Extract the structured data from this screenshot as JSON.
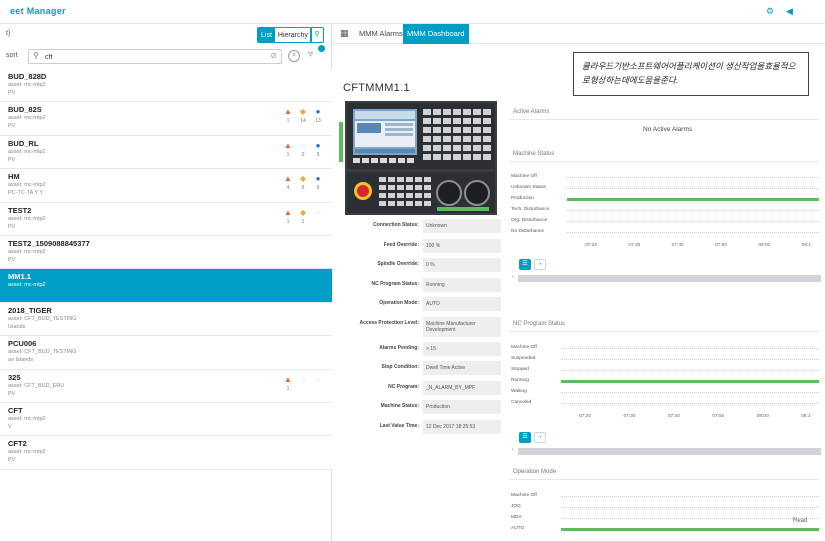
{
  "header": {
    "title": "eet Manager",
    "icons": [
      "settings-icon",
      "collapse-icon"
    ],
    "accent": "#009ec6"
  },
  "left": {
    "top_label": "t)",
    "view_toggle": {
      "list": "List",
      "hierarchy": "Hierarchy"
    },
    "sort_label": "sort",
    "search": {
      "value": "cft",
      "placeholder": ""
    },
    "assets": [
      {
        "name": "BUD_828D",
        "sub": "asset: mc-mtp2",
        "sub2": "PV",
        "icons": []
      },
      {
        "name": "BUD_82S",
        "sub": "asset: mc-mtp2",
        "sub2": "PV",
        "icons": [
          {
            "type": "alert",
            "count": "1"
          },
          {
            "type": "warn",
            "count": "14"
          },
          {
            "type": "info",
            "count": "13"
          }
        ]
      },
      {
        "name": "BUD_RL",
        "sub": "asset: mc-mtp2",
        "sub2": "PV",
        "icons": [
          {
            "type": "alert",
            "count": "1"
          },
          {
            "type": "empty",
            "count": "0"
          },
          {
            "type": "info",
            "count": "5"
          }
        ]
      },
      {
        "name": "HM",
        "sub": "asset: mc-mtp2",
        "sub2": "PC-TC-TA Y Y",
        "icons": [
          {
            "type": "alert",
            "count": "4"
          },
          {
            "type": "warn",
            "count": "6"
          },
          {
            "type": "info",
            "count": "9"
          }
        ]
      },
      {
        "name": "TEST2",
        "sub": "asset: mc-mtp2",
        "sub2": "PV",
        "icons": [
          {
            "type": "alert",
            "count": "1"
          },
          {
            "type": "warn",
            "count": "1"
          },
          {
            "type": "empty",
            "count": ""
          }
        ]
      },
      {
        "name": "TEST2_1509088845377",
        "sub": "asset: mc-mtp2",
        "sub2": "PV",
        "icons": []
      },
      {
        "name": "MM1.1",
        "sub": "asset: mc-mtp2",
        "sub2": "",
        "icons": [],
        "selected": true
      },
      {
        "name": "2018_TIGER",
        "sub": "asset: CFT_BUD_TESTING",
        "sub2": "Islands",
        "icons": []
      },
      {
        "name": "PCU006",
        "sub": "asset: CFT_BUD_TESTING",
        "sub2": "an Islands",
        "icons": []
      },
      {
        "name": "325",
        "sub": "asset: CFT_BUD_ERU",
        "sub2": "PV",
        "icons": [
          {
            "type": "alert",
            "count": "1"
          },
          {
            "type": "empty",
            "count": ""
          },
          {
            "type": "empty",
            "count": ""
          }
        ]
      },
      {
        "name": "CFT",
        "sub": "asset: mc-mtp2",
        "sub2": "V",
        "icons": []
      },
      {
        "name": "CFT2",
        "sub": "asset: mc-mtp2",
        "sub2": "PV",
        "icons": []
      }
    ]
  },
  "right": {
    "tabs": [
      "MMM Alarms",
      "MMM Dashboard"
    ],
    "active_tab": 1,
    "callout": "클라우드기반소프트웨어어플리케이션이 생산작업을효율적으로형상하는데에도움을준다.",
    "machine_title": "CFTMMM1.1",
    "info": [
      {
        "label": "Connection Status:",
        "value": "Unknown"
      },
      {
        "label": "Feed Override:",
        "value": "100 %"
      },
      {
        "label": "Spindle Override:",
        "value": "0 %"
      },
      {
        "label": "NC Program Status:",
        "value": "Running"
      },
      {
        "label": "Operation Mode:",
        "value": "AUTO"
      },
      {
        "label": "Access Protection Level:",
        "value": "Machine Manufacturer Development"
      },
      {
        "label": "Alarms Pending:",
        "value": "> 15"
      },
      {
        "label": "Stop Condition:",
        "value": "Dwell Time Active"
      },
      {
        "label": "NC Program:",
        "value": "_N_ALARM_BY_MPF"
      },
      {
        "label": "Machine Status:",
        "value": "Production"
      },
      {
        "label": "Last Value Time:",
        "value": "12 Dec 2017 18:25:53"
      }
    ],
    "active_alarms": {
      "title": "Active Alarms",
      "message": "No Active Alarms"
    },
    "machine_status": {
      "title": "Machine Status",
      "states": [
        "Machine Off",
        "Unknown Status",
        "Production",
        "Tech. Disturbance",
        "Org. Disturbance",
        "No Disturbance"
      ],
      "active_state": 2
    },
    "nc_program_status": {
      "title": "NC Program Status",
      "states": [
        "Machine Off",
        "Suspended",
        "Stopped",
        "Running",
        "Waiting",
        "Canceled"
      ],
      "active_state": 3
    },
    "operation_mode": {
      "title": "Operation Mode",
      "states": [
        "Machine Off",
        "JOG",
        "MDA",
        "AUTO"
      ],
      "active_state": 3
    },
    "ticks_a": [
      "07:20",
      "07:30",
      "07:40",
      "07:50",
      "08:00",
      "08:1"
    ],
    "ticks_b": [
      "07:20",
      "07:30",
      "07:40",
      "07:50",
      "08:00",
      "08:1"
    ],
    "read_more": "Read",
    "bar_color": "#5cbd5c"
  }
}
